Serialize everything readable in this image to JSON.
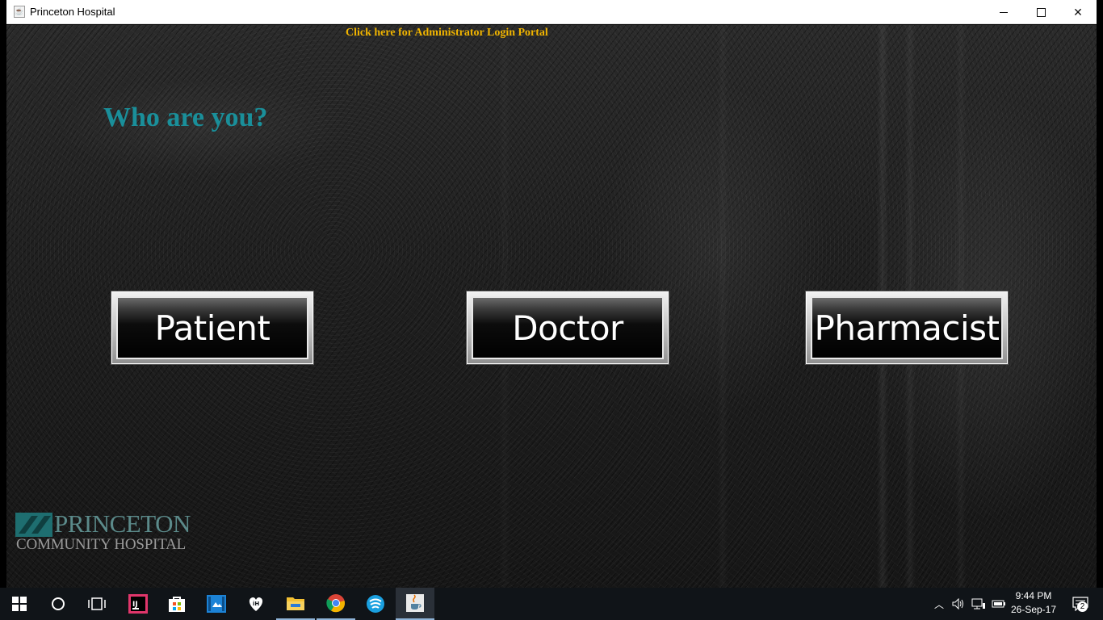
{
  "window": {
    "title": "Princeton Hospital",
    "app_icon": "java-cup-icon",
    "controls": [
      "minimize-icon",
      "maximize-icon",
      "close-icon"
    ]
  },
  "content": {
    "admin_link": "Click here for Administrator Login Portal",
    "heading": "Who are you?",
    "roles": {
      "patient": "Patient",
      "doctor": "Doctor",
      "pharmacist": "Pharmacist"
    },
    "logo": {
      "line1": "PRINCETON",
      "line2": "COMMUNITY HOSPITAL"
    }
  },
  "colors": {
    "admin_link": "#f0b400",
    "heading": "#1a8f9a",
    "logo_primary": "#5b8a8a",
    "taskbar": "#101418"
  },
  "taskbar": {
    "pinned": [
      "start-icon",
      "cortana-icon",
      "task-view-icon",
      "intellij-icon",
      "store-icon",
      "photos-icon",
      "iheartradio-icon",
      "file-explorer-icon",
      "chrome-icon",
      "zune-icon",
      "java-icon"
    ],
    "tray_icons": [
      "chevron-up-icon",
      "volume-icon",
      "network-icon",
      "battery-icon"
    ],
    "clock": {
      "time": "9:44 PM",
      "date": "26-Sep-17"
    },
    "notification_count": "2"
  }
}
